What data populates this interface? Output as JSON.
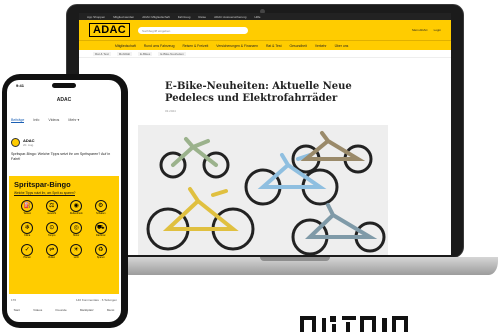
{
  "laptop": {
    "topbar": [
      "App Shoppen",
      "Mitglied werden",
      "ADAC Mitgliedschaft",
      "Fahrzeug",
      "Reise",
      "ADAC Autoversicherung",
      "Hilfe"
    ],
    "brand": "ADAC",
    "search_placeholder": "Suchbegriff eingeben",
    "header_util": [
      "Mein ADAC",
      "Login"
    ],
    "nav": [
      "Mitgliedschaft",
      "Rund ums Fahrzeug",
      "Reisen & Freizeit",
      "Versicherungen & Finanzen",
      "Rat & Test",
      "Gesundheit",
      "Verkehr",
      "Über uns"
    ],
    "breadcrumb": [
      "Rat & Test",
      "Mobilität",
      "E-Bikes",
      "E-Bike-Neuheiten"
    ],
    "article": {
      "title": "E-Bike-Neuheiten: Aktuelle Neue Pedelecs und Elektrofahrräder",
      "date": "03.2024"
    }
  },
  "phone": {
    "time": "9:41",
    "nav_title": "ADAC",
    "tabs": [
      "Beiträge",
      "Info",
      "Videos",
      "Mehr ▾"
    ],
    "profile_name": "ADAC",
    "profile_date": "20. Aug.",
    "post_text": "Spritspar-Bingo: Welche Tipps setzt ihr um Spritsparen? Auf in Fahrt!",
    "bingo_title": "Spritspar-Bingo",
    "bingo_subtitle": "Welche Tipps nutzt ihr, um Sprit zu sparen?",
    "bingo_cells": [
      {
        "icon": "⛽",
        "label": "Tanken"
      },
      {
        "icon": "⚖",
        "label": "Gewicht"
      },
      {
        "icon": "◉",
        "label": "Reifendruck"
      },
      {
        "icon": "⚙",
        "label": "Schalten"
      },
      {
        "icon": "❄",
        "label": "Klima"
      },
      {
        "icon": "⊙",
        "label": "Tempo"
      },
      {
        "icon": "◎",
        "label": "Motor"
      },
      {
        "icon": "⛟",
        "label": "Dachbox"
      },
      {
        "icon": "✓",
        "label": "Planen"
      },
      {
        "icon": "⇌",
        "label": "Rollen"
      },
      {
        "icon": "☀",
        "label": "Licht"
      },
      {
        "icon": "♻",
        "label": "Sparen"
      }
    ],
    "stats_left": "176",
    "stats_right": "140 Kommentare · 6 Teilungen",
    "bottom_nav": [
      "Start",
      "Videos",
      "Freunde",
      "Marktplatz",
      "Menü"
    ]
  },
  "colors": {
    "brand_yellow": "#ffcc00",
    "dark": "#1b1b1b"
  }
}
